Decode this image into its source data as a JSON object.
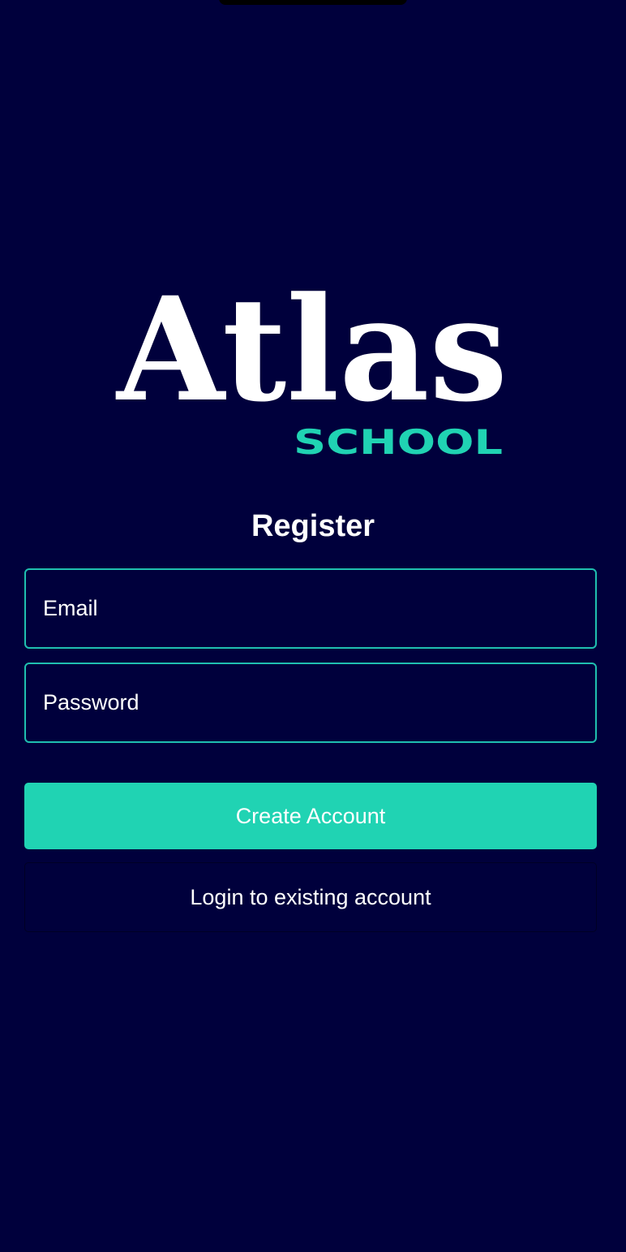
{
  "colors": {
    "background": "#00003c",
    "accent": "#20d3b3",
    "field_border": "#1fbfb0",
    "text": "#ffffff"
  },
  "logo": {
    "name": "Atlas",
    "tagline": "SCHOOL"
  },
  "form": {
    "title": "Register",
    "email_placeholder": "Email",
    "password_placeholder": "Password",
    "create_label": "Create Account",
    "login_label": "Login to existing account"
  }
}
